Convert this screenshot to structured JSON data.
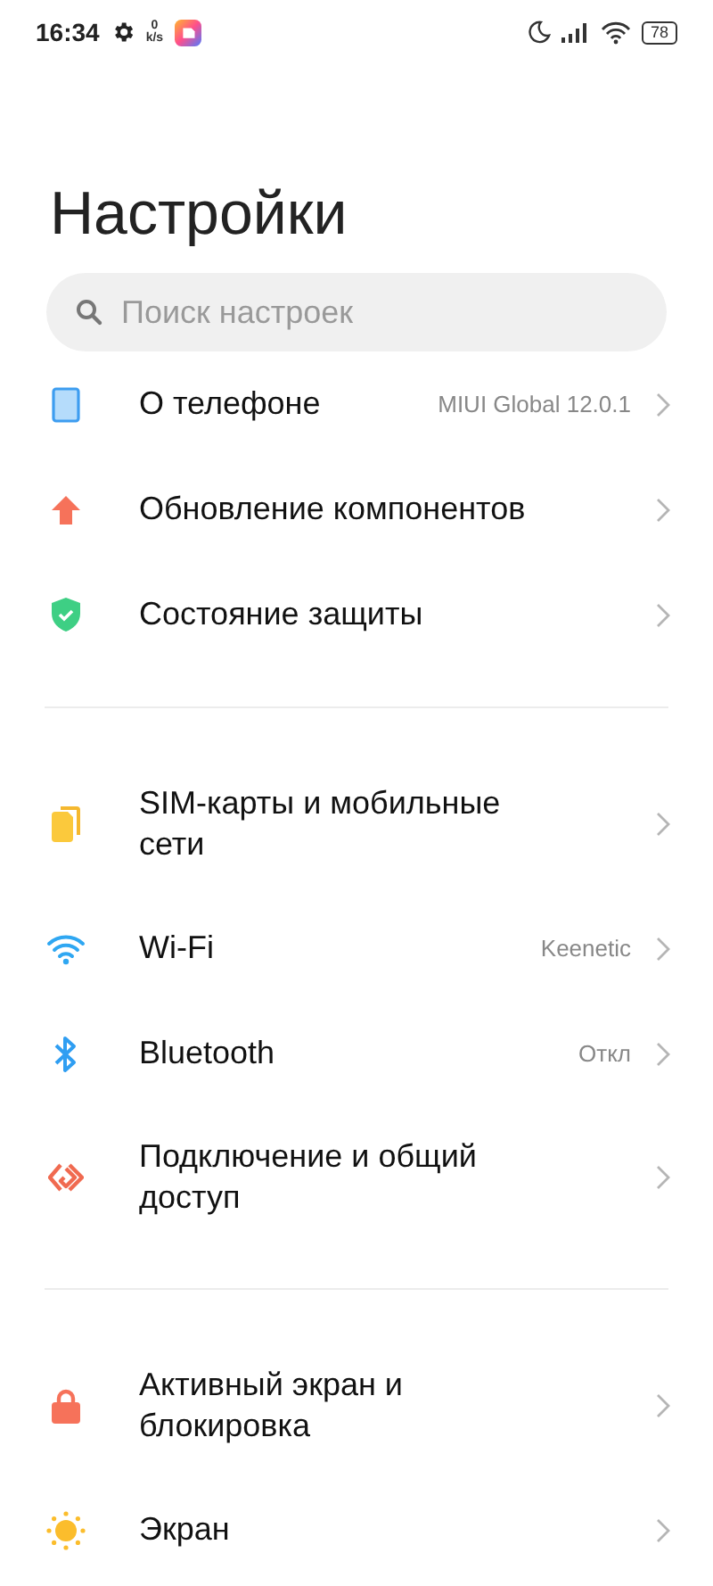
{
  "status_bar": {
    "time": "16:34",
    "net_speed": "0",
    "net_unit": "k/s",
    "battery": "78"
  },
  "title": "Настройки",
  "search": {
    "placeholder": "Поиск настроек"
  },
  "sections": [
    {
      "items": [
        {
          "kind": "phone",
          "label": "О телефоне",
          "value": "MIUI Global 12.0.1"
        },
        {
          "kind": "update",
          "label": "Обновление компонентов"
        },
        {
          "kind": "shield",
          "label": "Состояние защиты"
        }
      ]
    },
    {
      "items": [
        {
          "kind": "sim",
          "label": "SIM-карты и мобильные сети"
        },
        {
          "kind": "wifi",
          "label": "Wi-Fi",
          "value": "Keenetic"
        },
        {
          "kind": "bluetooth",
          "label": "Bluetooth",
          "value": "Откл"
        },
        {
          "kind": "share",
          "label": "Подключение и общий доступ"
        }
      ]
    },
    {
      "items": [
        {
          "kind": "lock",
          "label": "Активный экран и блокировка"
        },
        {
          "kind": "sun",
          "label": "Экран"
        }
      ]
    }
  ]
}
